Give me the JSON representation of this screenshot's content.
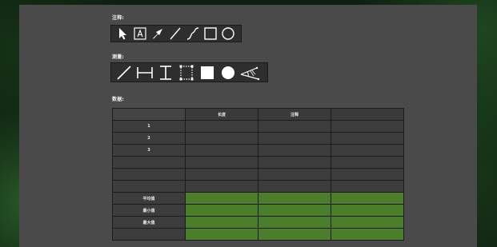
{
  "sections": {
    "annotation_label": "注释:",
    "measure_label": "测量:",
    "data_label": "数据:"
  },
  "annotation_tools": [
    {
      "name": "select-arrow-icon"
    },
    {
      "name": "text-box-icon",
      "glyph": "A"
    },
    {
      "name": "arrow-icon"
    },
    {
      "name": "line-icon"
    },
    {
      "name": "curve-icon"
    },
    {
      "name": "rectangle-icon"
    },
    {
      "name": "circle-icon"
    }
  ],
  "measure_tools": [
    {
      "name": "measure-line-icon"
    },
    {
      "name": "horizontal-measure-icon"
    },
    {
      "name": "vertical-measure-icon"
    },
    {
      "name": "rectangle-select-icon"
    },
    {
      "name": "filled-square-icon"
    },
    {
      "name": "filled-circle-icon"
    },
    {
      "name": "angle-measure-icon"
    }
  ],
  "table": {
    "headers": [
      "",
      "长度",
      "注释",
      ""
    ],
    "rows": [
      {
        "label": "1",
        "cells": [
          "",
          "",
          ""
        ]
      },
      {
        "label": "2",
        "cells": [
          "",
          "",
          ""
        ]
      },
      {
        "label": "3",
        "cells": [
          "",
          "",
          ""
        ]
      },
      {
        "label": "",
        "cells": [
          "",
          "",
          ""
        ]
      },
      {
        "label": "",
        "cells": [
          "",
          "",
          ""
        ]
      },
      {
        "label": "",
        "cells": [
          "",
          "",
          ""
        ]
      }
    ],
    "stat_rows": [
      {
        "label": "平均值",
        "cells": [
          "",
          "",
          ""
        ]
      },
      {
        "label": "最小值",
        "cells": [
          "",
          "",
          ""
        ]
      },
      {
        "label": "最大值",
        "cells": [
          "",
          "",
          ""
        ]
      },
      {
        "label": "",
        "cells": [
          "",
          "",
          ""
        ]
      }
    ]
  },
  "colors": {
    "panel": "#4a4a4a",
    "toolbar": "#2e2e2e",
    "stat_fill": "#4c7d2a",
    "icon": "#ffffff"
  }
}
